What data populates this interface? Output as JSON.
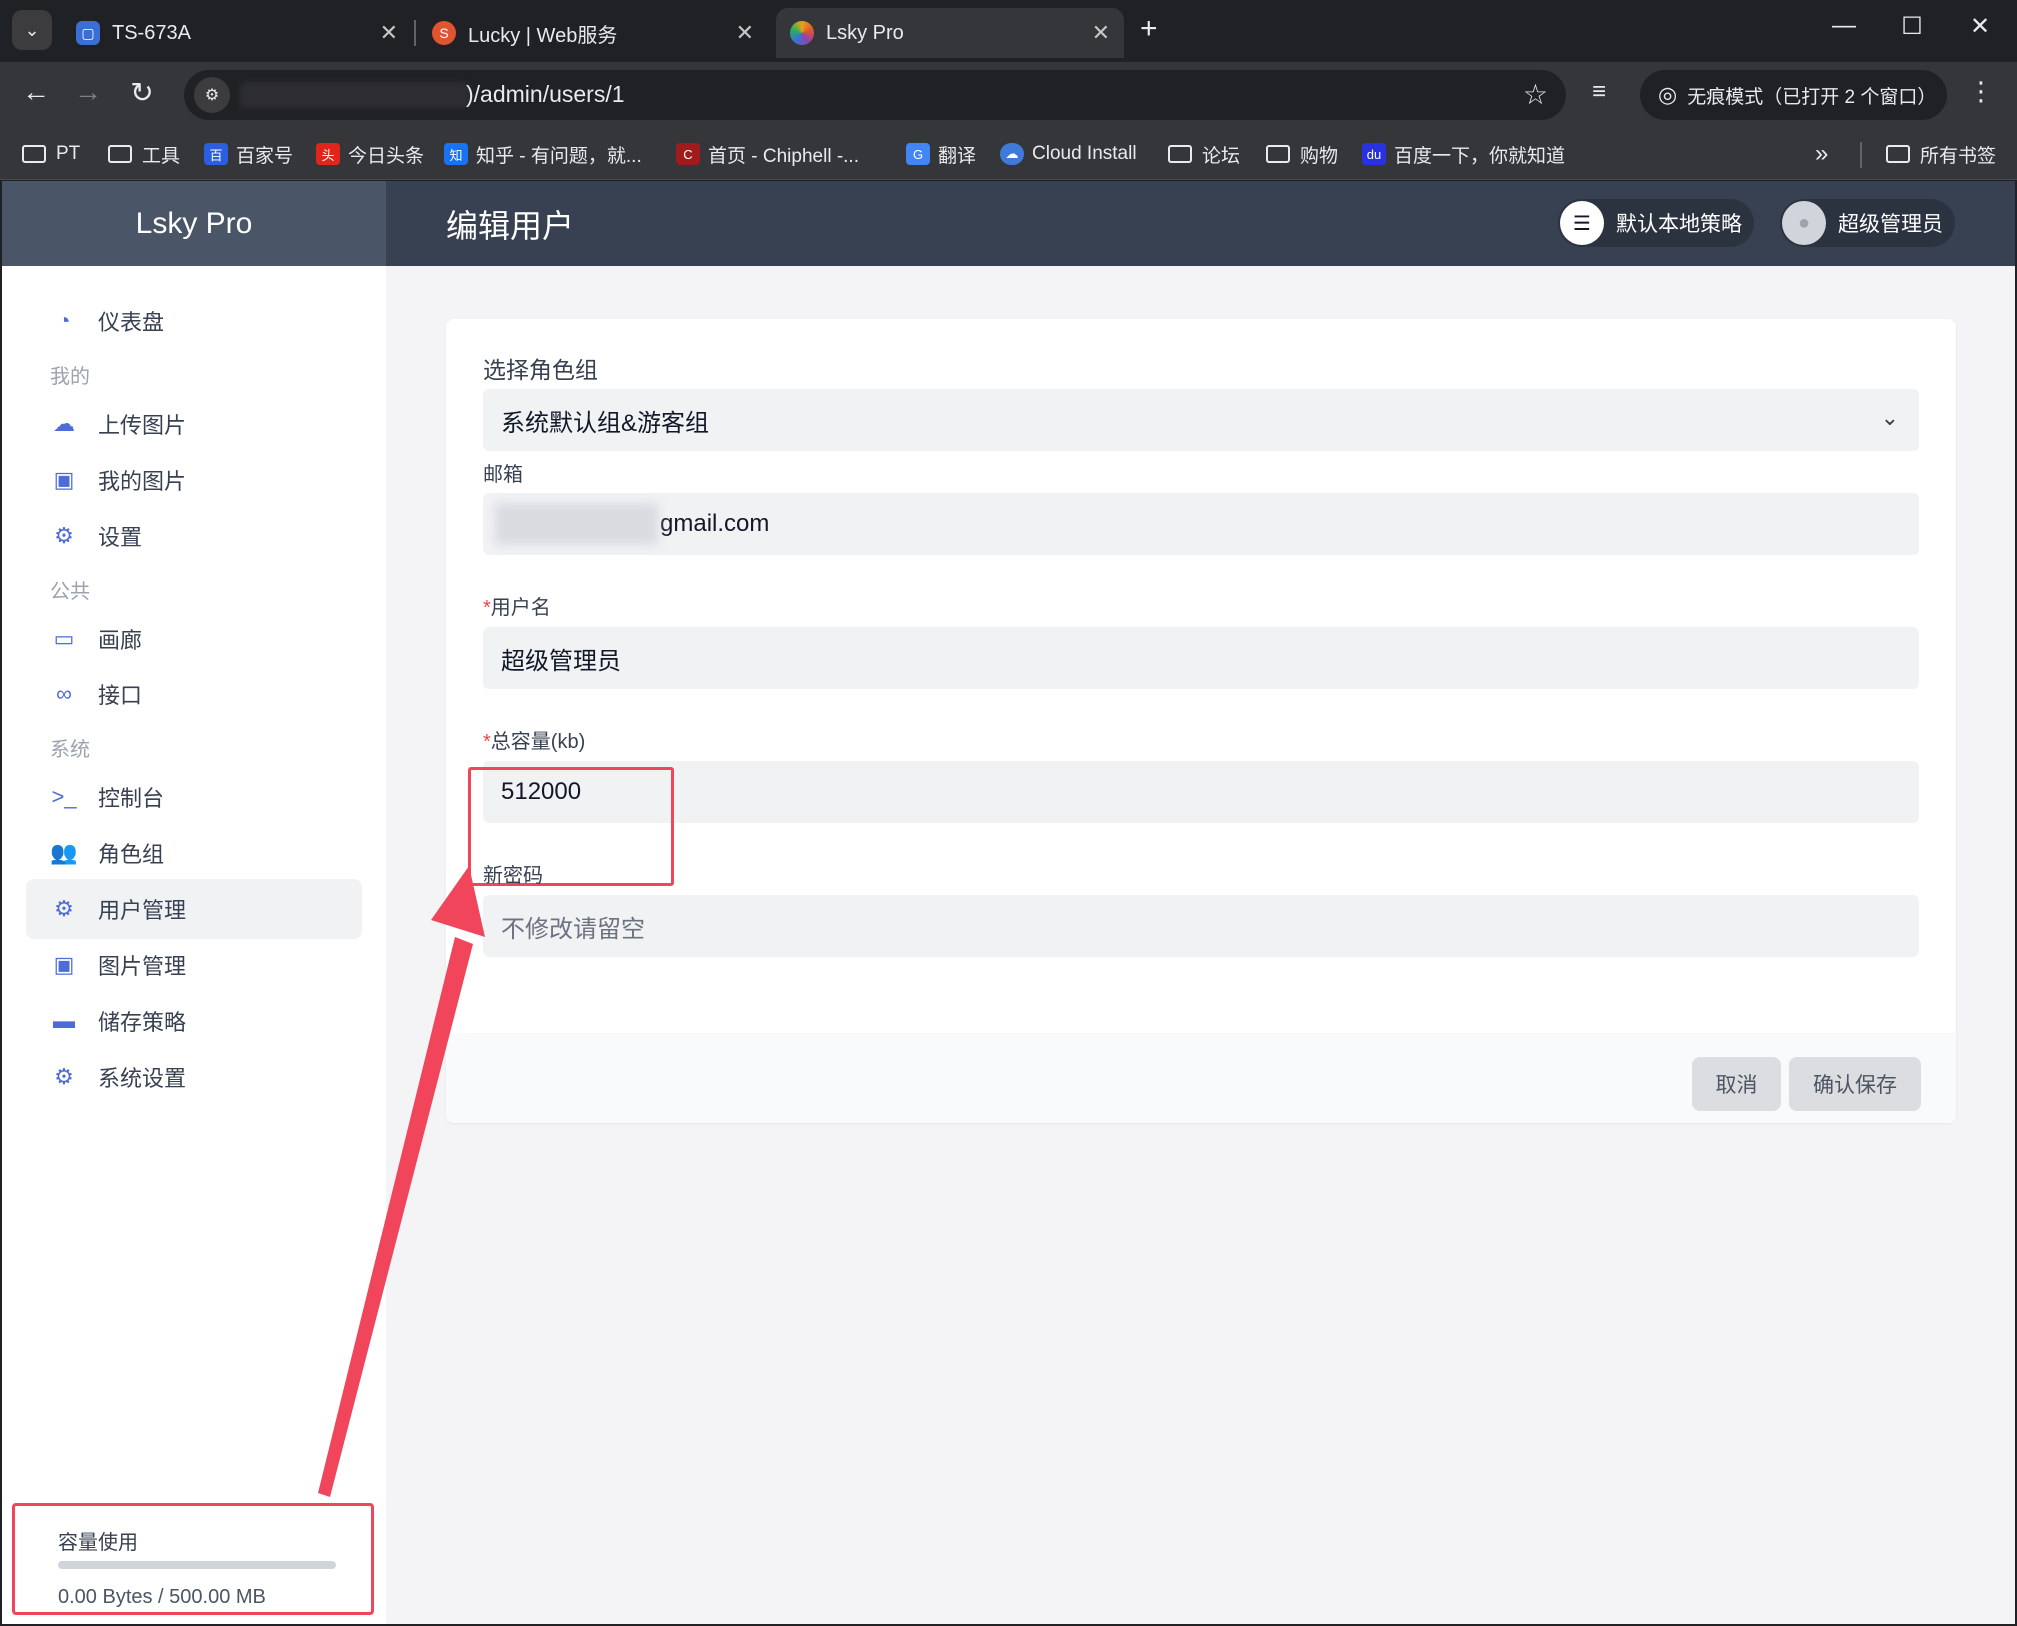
{
  "browser": {
    "tabs": [
      {
        "title": "TS-673A",
        "favicon_color": "#3b6fd6"
      },
      {
        "title": "Lucky | Web服务",
        "favicon_color": "#e0542f"
      },
      {
        "title": "Lsky Pro",
        "favicon_color": "#e8a317"
      }
    ],
    "url": ")/admin/users/1",
    "incognito_label": "无痕模式（已打开 2 个窗口）",
    "bookmarks": [
      {
        "label": "PT",
        "kind": "folder"
      },
      {
        "label": "工具",
        "kind": "folder"
      },
      {
        "label": "百家号",
        "kind": "site",
        "color": "#2b5fe0"
      },
      {
        "label": "今日头条",
        "kind": "site",
        "color": "#e1251b"
      },
      {
        "label": "知乎 - 有问题，就...",
        "kind": "site",
        "color": "#1772f6"
      },
      {
        "label": "首页 - Chiphell -...",
        "kind": "site",
        "color": "#a01c1c"
      },
      {
        "label": "翻译",
        "kind": "site",
        "color": "#4285f4"
      },
      {
        "label": "Cloud Install",
        "kind": "site",
        "color": "#3e7bd8"
      },
      {
        "label": "论坛",
        "kind": "folder"
      },
      {
        "label": "购物",
        "kind": "folder"
      },
      {
        "label": "百度一下，你就知道",
        "kind": "site",
        "color": "#2932e1"
      }
    ],
    "all_bookmarks_label": "所有书签"
  },
  "app": {
    "brand": "Lsky Pro",
    "page_title": "编辑用户",
    "strategy_label": "默认本地策略",
    "user_label": "超级管理员"
  },
  "sidebar": {
    "dashboard": "仪表盘",
    "section_mine": "我的",
    "upload": "上传图片",
    "my_images": "我的图片",
    "settings": "设置",
    "section_public": "公共",
    "gallery": "画廊",
    "api": "接口",
    "section_system": "系统",
    "console": "控制台",
    "roles": "角色组",
    "users": "用户管理",
    "images_admin": "图片管理",
    "storage": "储存策略",
    "system_settings": "系统设置"
  },
  "usage": {
    "title": "容量使用",
    "value": "0.00 Bytes / 500.00 MB",
    "used_fraction": 0
  },
  "form": {
    "role_label": "选择角色组",
    "role_value": "系统默认组&游客组",
    "email_label": "邮箱",
    "email_value_visible": "gmail.com",
    "username_label": "用户名",
    "username_value": "超级管理员",
    "capacity_label": "总容量(kb)",
    "capacity_value": "512000",
    "password_label": "新密码",
    "password_placeholder": "不修改请留空",
    "required_mark": "*",
    "cancel_label": "取消",
    "save_label": "确认保存"
  },
  "colors": {
    "accent": "#4f6bd8",
    "header_bg": "#374151",
    "highlight": "#f0455a"
  }
}
